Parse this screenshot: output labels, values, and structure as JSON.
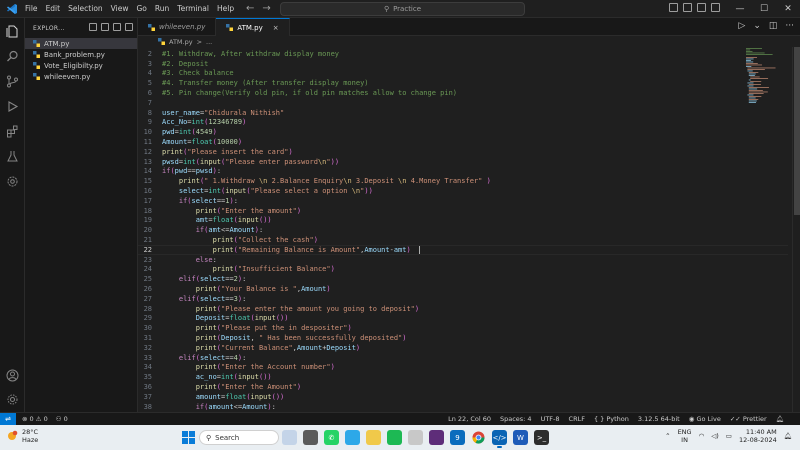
{
  "menu": [
    "File",
    "Edit",
    "Selection",
    "View",
    "Go",
    "Run",
    "Terminal",
    "Help"
  ],
  "search": {
    "label": "Practice"
  },
  "explorer": {
    "title": "EXPLOR...",
    "files": [
      {
        "name": "ATM.py",
        "active": true
      },
      {
        "name": "Bank_problem.py",
        "active": false
      },
      {
        "name": "Vote_Eligibilty.py",
        "active": false
      },
      {
        "name": "whileeven.py",
        "active": false
      }
    ]
  },
  "tabs": [
    {
      "label": "whileeven.py",
      "active": false
    },
    {
      "label": "ATM.py",
      "active": true
    }
  ],
  "breadcrumb": {
    "file": "ATM.py",
    "sep": ">",
    "rest": "..."
  },
  "editor": {
    "current_line": 22,
    "lines": [
      {
        "n": "2",
        "t": "#1. Withdraw, After withdraw display money"
      },
      {
        "n": "3",
        "t": "#2. Deposit"
      },
      {
        "n": "4",
        "t": "#3. Check balance"
      },
      {
        "n": "5",
        "t": "#4. Transfer money (After transfer display money)"
      },
      {
        "n": "6",
        "t": "#5. Pin change(Verify old pin, if old pin matches allow to change pin)"
      },
      {
        "n": "7",
        "t": ""
      },
      {
        "n": "8",
        "t": "user_name=\"Chidurala Nithish\""
      },
      {
        "n": "9",
        "t": "Acc_No=int(12346789)"
      },
      {
        "n": "10",
        "t": "pwd=int(4549)"
      },
      {
        "n": "11",
        "t": "Amount=float(10000)"
      },
      {
        "n": "12",
        "t": "print(\"Please insert the card\")"
      },
      {
        "n": "13",
        "t": "pwsd=int(input(\"Please enter password\\n\"))"
      },
      {
        "n": "14",
        "t": "if(pwd==pwsd):"
      },
      {
        "n": "15",
        "t": "    print(\" 1.Withdraw \\n 2.Balance Enquiry\\n 3.Deposit \\n 4.Money Transfer\" )"
      },
      {
        "n": "16",
        "t": "    select=int(input(\"Please select a option \\n\"))"
      },
      {
        "n": "17",
        "t": "    if(select==1):"
      },
      {
        "n": "18",
        "t": "        print(\"Enter the amount\")"
      },
      {
        "n": "19",
        "t": "        amt=float(input())"
      },
      {
        "n": "20",
        "t": "        if(amt<=Amount):"
      },
      {
        "n": "21",
        "t": "            print(\"Collect the cash\")"
      },
      {
        "n": "22",
        "t": "            print(\"Remaining Balance is Amount\",Amount-amt)"
      },
      {
        "n": "23",
        "t": "        else:"
      },
      {
        "n": "24",
        "t": "            print(\"Insufficient Balance\")"
      },
      {
        "n": "25",
        "t": "    elif(select==2):"
      },
      {
        "n": "26",
        "t": "        print(\"Your Balance is \",Amount)"
      },
      {
        "n": "27",
        "t": "    elif(select==3):"
      },
      {
        "n": "28",
        "t": "        print(\"Please enter the amount you going to deposit\")"
      },
      {
        "n": "29",
        "t": "        Deposit=float(input())"
      },
      {
        "n": "30",
        "t": "        print(\"Please put the in despositer\")"
      },
      {
        "n": "31",
        "t": "        print(Deposit, \" Has been successfully deposited\")"
      },
      {
        "n": "32",
        "t": "        print(\"Current Balance\",Amount+Deposit)"
      },
      {
        "n": "33",
        "t": "    elif(select==4):"
      },
      {
        "n": "34",
        "t": "        print(\"Enter the Account number\")"
      },
      {
        "n": "35",
        "t": "        ac_no=int(input())"
      },
      {
        "n": "36",
        "t": "        print(\"Enter the Amount\")"
      },
      {
        "n": "37",
        "t": "        amount=float(input())"
      },
      {
        "n": "38",
        "t": "        if(amount<=Amount):"
      }
    ]
  },
  "status": {
    "errors": "0",
    "warnings": "0",
    "ports": "0",
    "position": "Ln 22, Col 60",
    "spaces": "Spaces: 4",
    "encoding": "UTF-8",
    "eol": "CRLF",
    "language": "Python",
    "interpreter": "3.12.5 64-bit",
    "golive": "Go Live",
    "prettier": "Prettier"
  },
  "taskbar": {
    "temp": "28°C",
    "weather": "Haze",
    "search": "Search",
    "badge": "9",
    "lang1": "ENG",
    "lang2": "IN",
    "time": "11:40 AM",
    "date": "12-08-2024"
  },
  "colors": {
    "keyword": "#c586c0",
    "function": "#dcdcaa",
    "string": "#ce9178",
    "number": "#b5cea8",
    "comment": "#6a9955",
    "variable": "#9cdcfe",
    "builtin": "#4ec9b0",
    "accent": "#0078d4"
  }
}
